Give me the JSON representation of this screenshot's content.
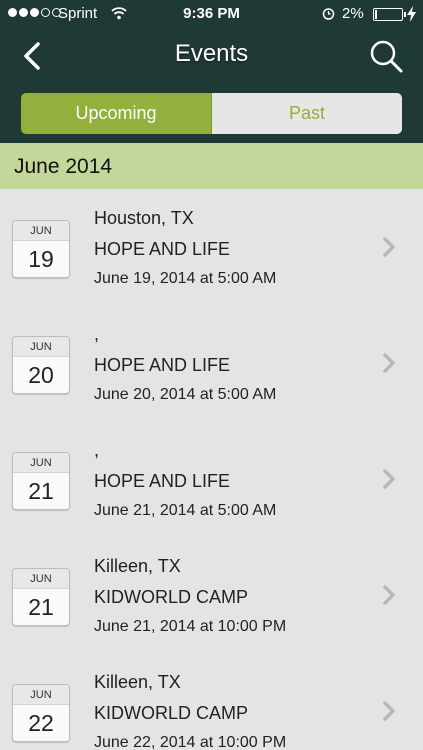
{
  "status_bar": {
    "carrier": "Sprint",
    "time": "9:36 PM",
    "battery": "2%",
    "signal_icon": "signal-dots-icon",
    "wifi_icon": "wifi-icon",
    "alarm_icon": "alarm-clock-icon",
    "battery_icon": "battery-icon",
    "charging_icon": "lightning-bolt-icon"
  },
  "nav": {
    "title": "Events",
    "back_icon": "chevron-left-icon",
    "search_icon": "search-icon"
  },
  "segments": {
    "upcoming": "Upcoming",
    "past": "Past",
    "selected": "Upcoming"
  },
  "section": {
    "title": "June 2014"
  },
  "events": [
    {
      "month": "JUN",
      "day": "19",
      "location": "Houston, TX",
      "name": "HOPE AND LIFE",
      "datetime": "June 19, 2014 at 5:00 AM"
    },
    {
      "month": "JUN",
      "day": "20",
      "location": ",",
      "name": "HOPE AND LIFE",
      "datetime": "June 20, 2014 at 5:00 AM"
    },
    {
      "month": "JUN",
      "day": "21",
      "location": ",",
      "name": "HOPE AND LIFE",
      "datetime": "June 21, 2014 at 5:00 AM"
    },
    {
      "month": "JUN",
      "day": "21",
      "location": "Killeen, TX",
      "name": "KIDWORLD CAMP",
      "datetime": "June 21, 2014 at 10:00 PM"
    },
    {
      "month": "JUN",
      "day": "22",
      "location": "Killeen, TX",
      "name": "KIDWORLD CAMP",
      "datetime": "June 22, 2014 at 10:00 PM"
    }
  ],
  "colors": {
    "nav_background": "#1f3a35",
    "accent_green": "#93b03c",
    "section_header": "#c4d79b",
    "list_background": "#e4e4e4"
  }
}
